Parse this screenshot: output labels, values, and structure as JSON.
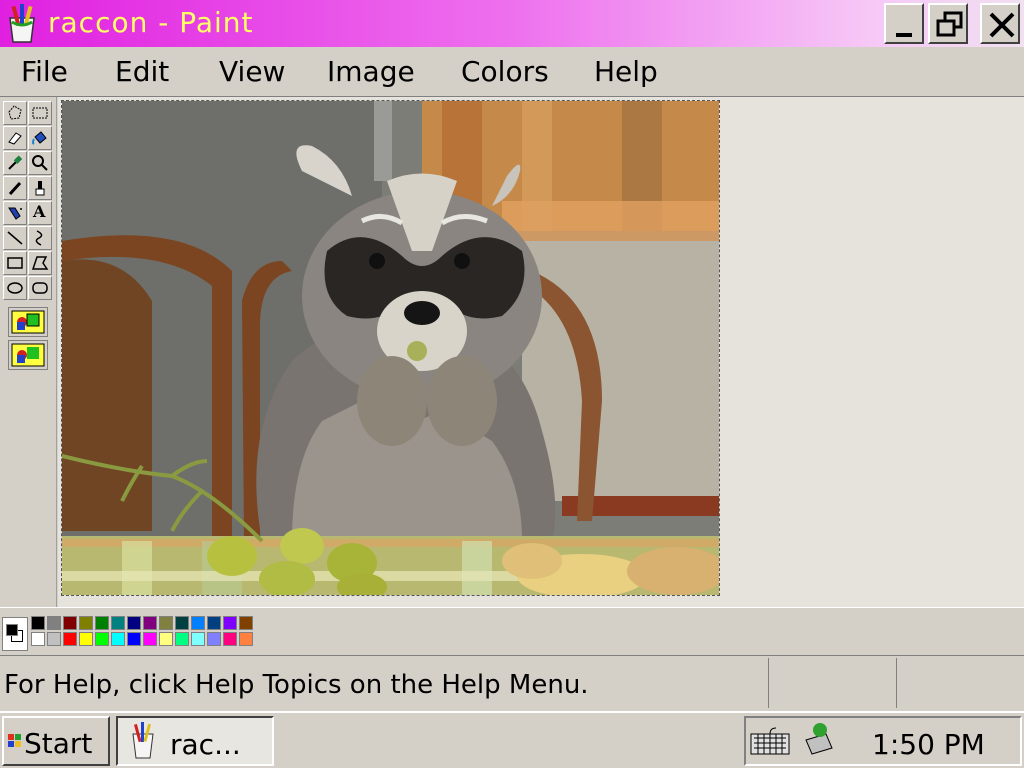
{
  "window": {
    "title": "raccon - Paint"
  },
  "menu": [
    "File",
    "Edit",
    "View",
    "Image",
    "Colors",
    "Help"
  ],
  "toolbox": {
    "tools": [
      "free-select-icon",
      "rect-select-icon",
      "eraser-icon",
      "fill-icon",
      "color-picker-icon",
      "magnifier-icon",
      "pencil-icon",
      "brush-icon",
      "airbrush-icon",
      "text-icon",
      "line-icon",
      "curve-icon",
      "rectangle-icon",
      "polygon-icon",
      "ellipse-icon",
      "rounded-rect-icon"
    ],
    "text_tool_glyph": "A"
  },
  "palette": {
    "foreground": "#000000",
    "background": "#ffffff",
    "row1": [
      "#000000",
      "#808080",
      "#800000",
      "#808000",
      "#008000",
      "#008080",
      "#000080",
      "#800080",
      "#808040",
      "#004040",
      "#0080ff",
      "#004080",
      "#8000ff",
      "#804000"
    ],
    "row2": [
      "#ffffff",
      "#c0c0c0",
      "#ff0000",
      "#ffff00",
      "#00ff00",
      "#00ffff",
      "#0000ff",
      "#ff00ff",
      "#ffff80",
      "#00ff80",
      "#80ffff",
      "#8080ff",
      "#ff0080",
      "#ff8040"
    ]
  },
  "status": {
    "help_text": "For Help, click Help Topics on the Help Menu."
  },
  "taskbar": {
    "start_label": "Start",
    "task_label": "rac...",
    "clock": "1:50 PM"
  },
  "colors": {
    "title_gradient_start": "#e020e0",
    "title_text": "#ffff66",
    "chrome": "#d4d0c8"
  }
}
